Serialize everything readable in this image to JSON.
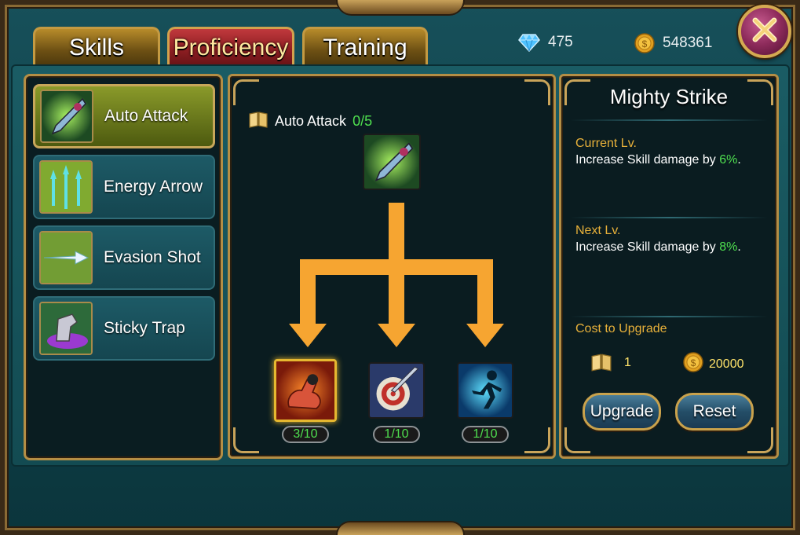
{
  "tabs": [
    {
      "label": "Skills"
    },
    {
      "label": "Proficiency"
    },
    {
      "label": "Training"
    }
  ],
  "active_tab": "Proficiency",
  "currency": {
    "gems": "475",
    "gold": "548361"
  },
  "skills": [
    {
      "name": "Auto Attack",
      "icon": "spear-icon",
      "selected": true
    },
    {
      "name": "Energy Arrow",
      "icon": "trident-arrow-icon",
      "selected": false
    },
    {
      "name": "Evasion Shot",
      "icon": "arrow-shot-icon",
      "selected": false
    },
    {
      "name": "Sticky Trap",
      "icon": "trap-icon",
      "selected": false
    }
  ],
  "tree": {
    "root_name": "Auto Attack",
    "root_progress": "0/5",
    "root_icon": "spear-icon",
    "children": [
      {
        "icon": "strength-icon",
        "level": "3/10",
        "selected": true
      },
      {
        "icon": "target-hit-icon",
        "level": "1/10",
        "selected": false
      },
      {
        "icon": "sprint-icon",
        "level": "1/10",
        "selected": false
      }
    ]
  },
  "detail": {
    "title": "Mighty Strike",
    "current_label": "Current Lv.",
    "current_text": "Increase Skill damage by ",
    "current_value": "6%",
    "current_suffix": ".",
    "next_label": "Next Lv.",
    "next_text": "Increase Skill damage by ",
    "next_value": "8%",
    "next_suffix": ".",
    "cost_label": "Cost to Upgrade",
    "cost_books": "1",
    "cost_gold": "20000",
    "upgrade_label": "Upgrade",
    "reset_label": "Reset"
  },
  "colors": {
    "accent_gold": "#c9a24c",
    "progress_green": "#4fe04f",
    "label_orange": "#e8b13a",
    "arrow_orange": "#f6a531"
  }
}
